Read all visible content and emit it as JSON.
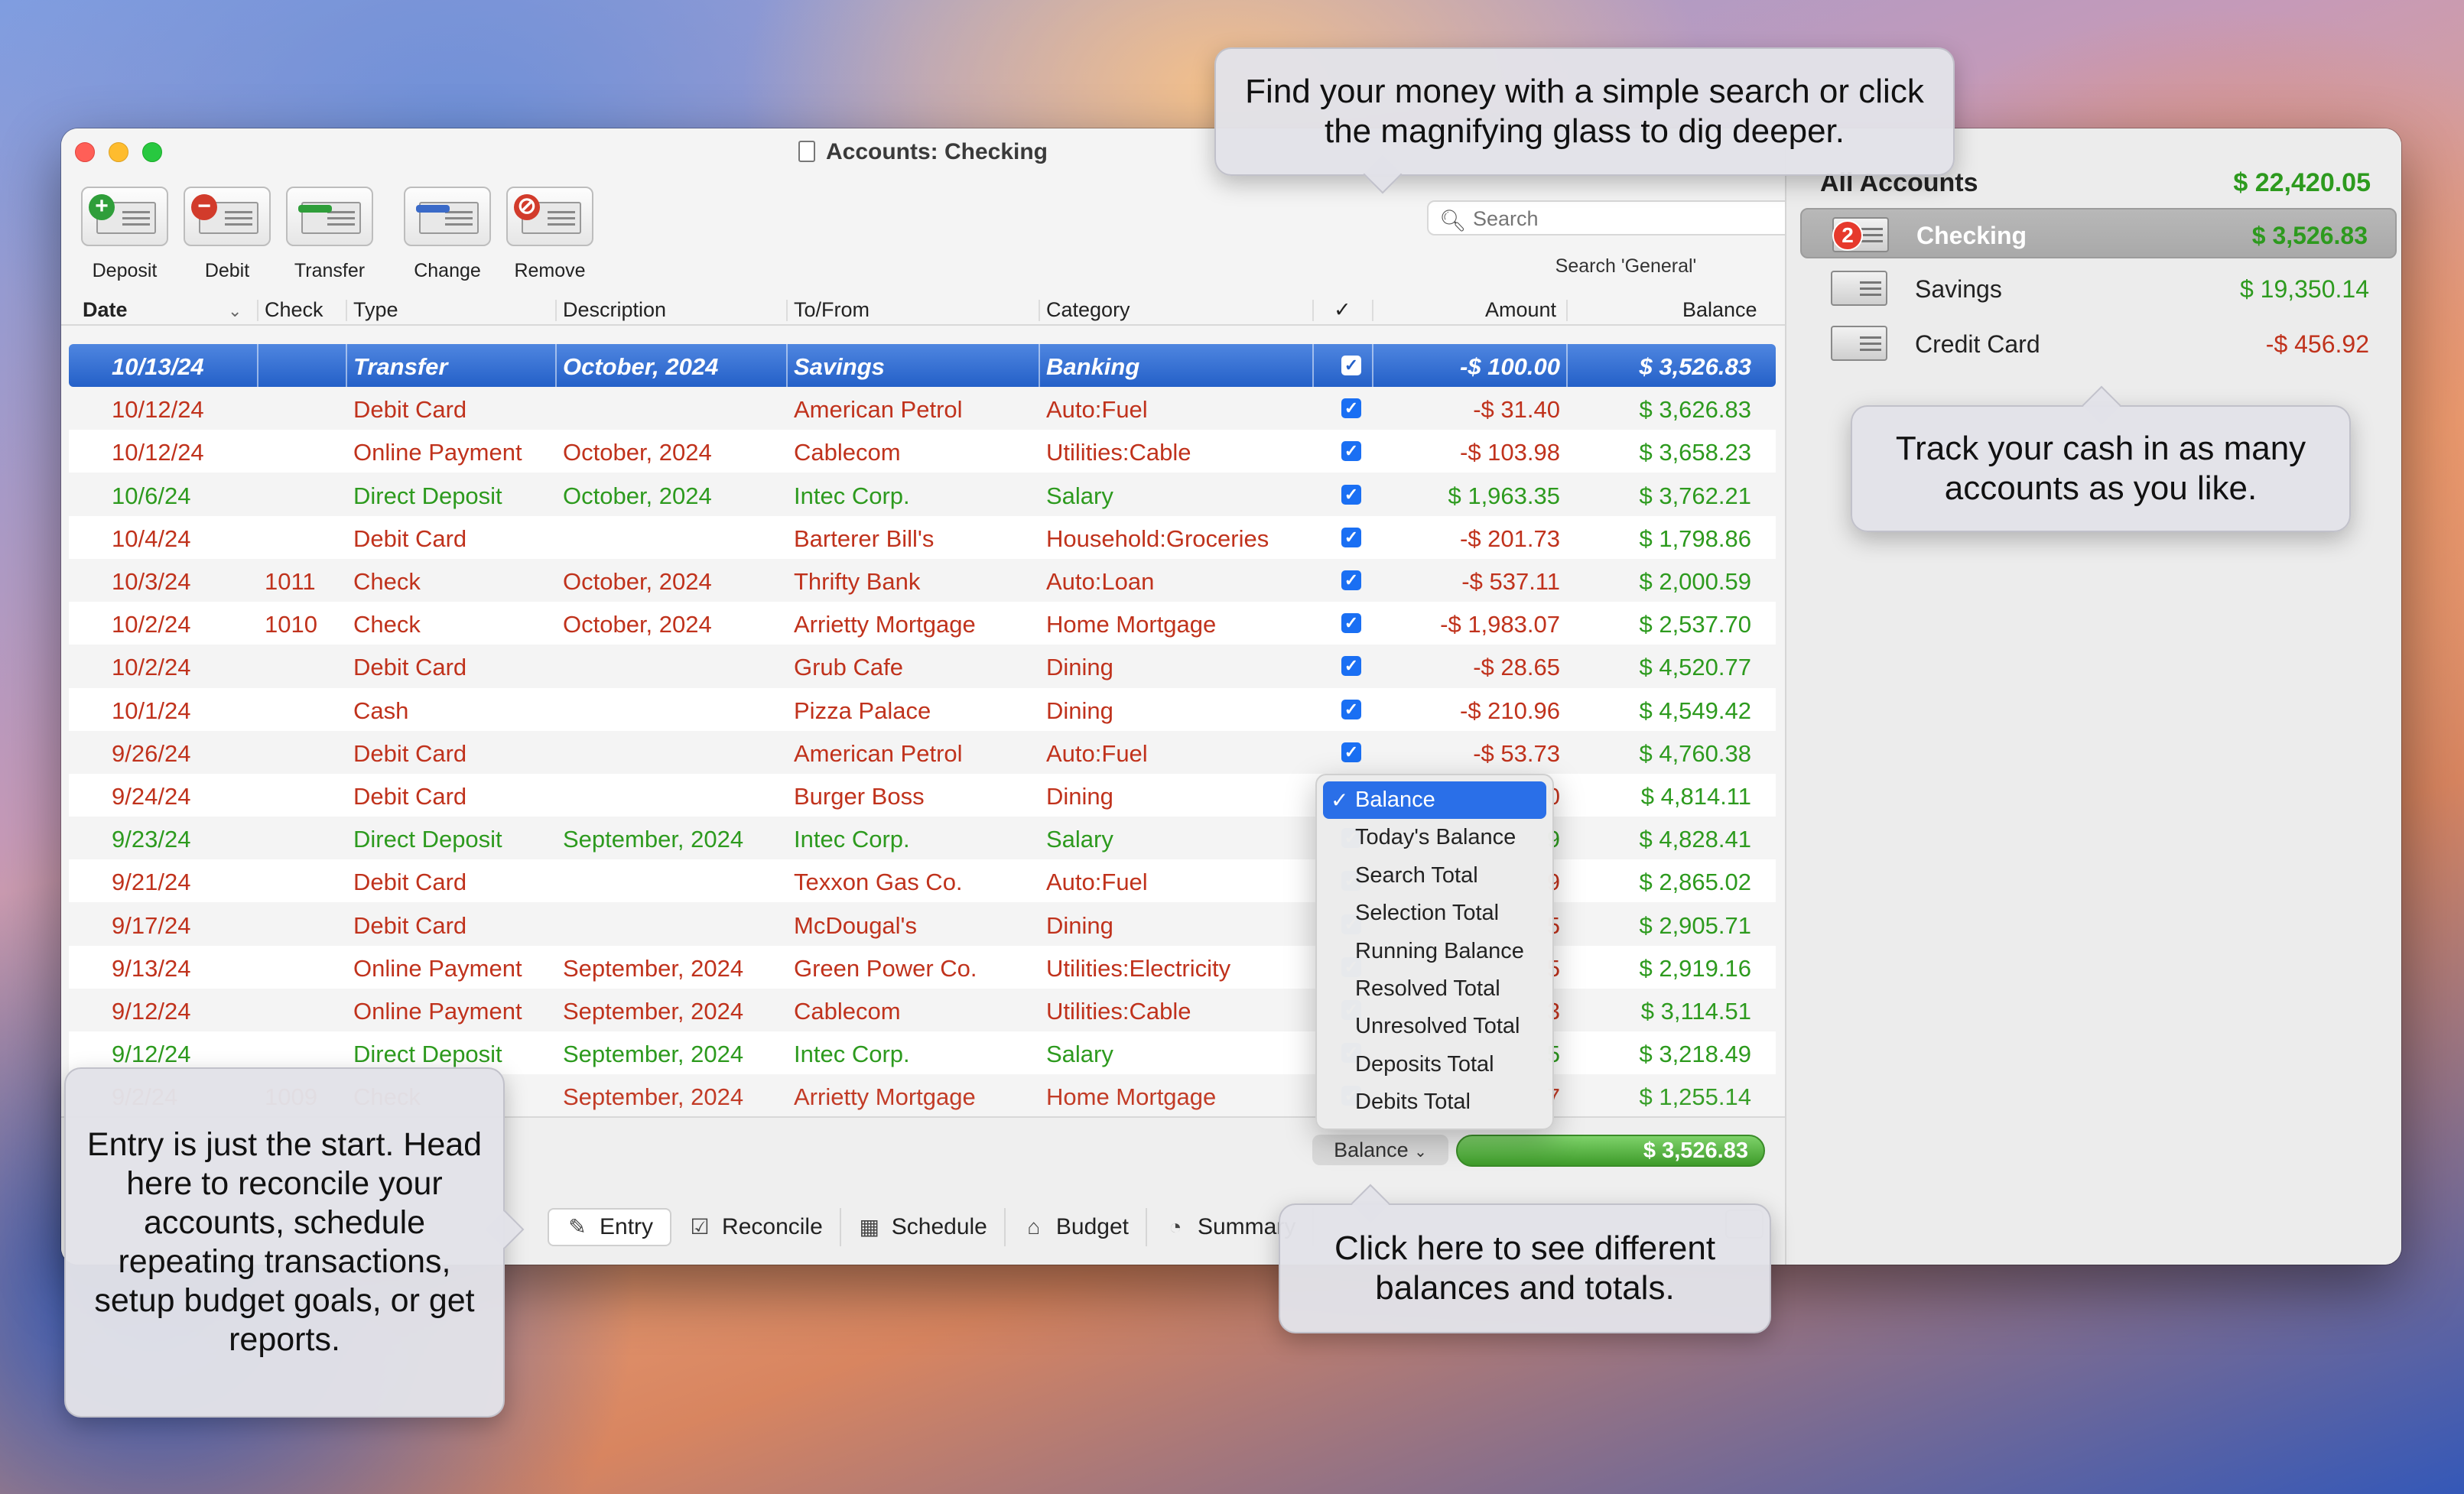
{
  "window": {
    "title": "Accounts:  Checking"
  },
  "toolbar": {
    "buttons": [
      {
        "label": "Deposit",
        "icon": "deposit-icon",
        "color": "#2f9e3a",
        "glyph": "+"
      },
      {
        "label": "Debit",
        "icon": "debit-icon",
        "color": "#d23b2b",
        "glyph": "−"
      },
      {
        "label": "Transfer",
        "icon": "transfer-icon",
        "color": "#2f9e3a",
        "glyph": ""
      },
      {
        "label": "Change",
        "icon": "change-icon",
        "color": "#3a6ac8",
        "glyph": ""
      },
      {
        "label": "Remove",
        "icon": "remove-icon",
        "color": "#d23b2b",
        "glyph": "⊘"
      }
    ]
  },
  "search": {
    "placeholder": "Search",
    "scope": "Search 'General'"
  },
  "columns": {
    "date": "Date",
    "check": "Check",
    "type": "Type",
    "description": "Description",
    "tofrom": "To/From",
    "category": "Category",
    "cleared": "✓",
    "amount": "Amount",
    "balance": "Balance"
  },
  "transactions": [
    {
      "date": "10/13/24",
      "check": "",
      "type": "Transfer",
      "description": "October, 2024",
      "tofrom": "Savings",
      "category": "Banking",
      "amount": "-$ 100.00",
      "balance": "$ 3,526.83",
      "kind": "sel"
    },
    {
      "date": "10/12/24",
      "check": "",
      "type": "Debit Card",
      "description": "",
      "tofrom": "American Petrol",
      "category": "Auto:Fuel",
      "amount": "-$ 31.40",
      "balance": "$ 3,626.83",
      "kind": "red"
    },
    {
      "date": "10/12/24",
      "check": "",
      "type": "Online Payment",
      "description": "October, 2024",
      "tofrom": "Cablecom",
      "category": "Utilities:Cable",
      "amount": "-$ 103.98",
      "balance": "$ 3,658.23",
      "kind": "red"
    },
    {
      "date": "10/6/24",
      "check": "",
      "type": "Direct Deposit",
      "description": "October, 2024",
      "tofrom": "Intec Corp.",
      "category": "Salary",
      "amount": "$ 1,963.35",
      "balance": "$ 3,762.21",
      "kind": "green"
    },
    {
      "date": "10/4/24",
      "check": "",
      "type": "Debit Card",
      "description": "",
      "tofrom": "Barterer Bill's",
      "category": "Household:Groceries",
      "amount": "-$ 201.73",
      "balance": "$ 1,798.86",
      "kind": "red"
    },
    {
      "date": "10/3/24",
      "check": "1011",
      "type": "Check",
      "description": "October, 2024",
      "tofrom": "Thrifty Bank",
      "category": "Auto:Loan",
      "amount": "-$ 537.11",
      "balance": "$ 2,000.59",
      "kind": "red"
    },
    {
      "date": "10/2/24",
      "check": "1010",
      "type": "Check",
      "description": "October, 2024",
      "tofrom": "Arrietty Mortgage",
      "category": "Home Mortgage",
      "amount": "-$ 1,983.07",
      "balance": "$ 2,537.70",
      "kind": "red"
    },
    {
      "date": "10/2/24",
      "check": "",
      "type": "Debit Card",
      "description": "",
      "tofrom": "Grub Cafe",
      "category": "Dining",
      "amount": "-$ 28.65",
      "balance": "$ 4,520.77",
      "kind": "red"
    },
    {
      "date": "10/1/24",
      "check": "",
      "type": "Cash",
      "description": "",
      "tofrom": "Pizza Palace",
      "category": "Dining",
      "amount": "-$ 210.96",
      "balance": "$ 4,549.42",
      "kind": "red"
    },
    {
      "date": "9/26/24",
      "check": "",
      "type": "Debit Card",
      "description": "",
      "tofrom": "American Petrol",
      "category": "Auto:Fuel",
      "amount": "-$ 53.73",
      "balance": "$ 4,760.38",
      "kind": "red"
    },
    {
      "date": "9/24/24",
      "check": "",
      "type": "Debit Card",
      "description": "",
      "tofrom": "Burger Boss",
      "category": "Dining",
      "amount": "0",
      "balance": "$ 4,814.11",
      "kind": "red"
    },
    {
      "date": "9/23/24",
      "check": "",
      "type": "Direct Deposit",
      "description": "September, 2024",
      "tofrom": "Intec Corp.",
      "category": "Salary",
      "amount": "9",
      "balance": "$ 4,828.41",
      "kind": "green"
    },
    {
      "date": "9/21/24",
      "check": "",
      "type": "Debit Card",
      "description": "",
      "tofrom": "Texxon Gas Co.",
      "category": "Auto:Fuel",
      "amount": "9",
      "balance": "$ 2,865.02",
      "kind": "red"
    },
    {
      "date": "9/17/24",
      "check": "",
      "type": "Debit Card",
      "description": "",
      "tofrom": "McDougal's",
      "category": "Dining",
      "amount": "5",
      "balance": "$ 2,905.71",
      "kind": "red"
    },
    {
      "date": "9/13/24",
      "check": "",
      "type": "Online Payment",
      "description": "September, 2024",
      "tofrom": "Green Power Co.",
      "category": "Utilities:Electricity",
      "amount": "5",
      "balance": "$ 2,919.16",
      "kind": "red"
    },
    {
      "date": "9/12/24",
      "check": "",
      "type": "Online Payment",
      "description": "September, 2024",
      "tofrom": "Cablecom",
      "category": "Utilities:Cable",
      "amount": "3",
      "balance": "$ 3,114.51",
      "kind": "red"
    },
    {
      "date": "9/12/24",
      "check": "",
      "type": "Direct Deposit",
      "description": "September, 2024",
      "tofrom": "Intec Corp.",
      "category": "Salary",
      "amount": "5",
      "balance": "$ 3,218.49",
      "kind": "green"
    },
    {
      "date": "9/2/24",
      "check": "1009",
      "type": "Check",
      "description": "September, 2024",
      "tofrom": "Arrietty Mortgage",
      "category": "Home Mortgage",
      "amount": "7",
      "balance": "$ 1,255.14",
      "kind": "red"
    }
  ],
  "balance_control": {
    "label": "Balance",
    "value": "$ 3,526.83"
  },
  "balance_menu": {
    "items": [
      "Balance",
      "Today's Balance",
      "Search Total",
      "Selection Total",
      "Running Balance",
      "Resolved Total",
      "Unresolved Total",
      "Deposits Total",
      "Debits Total"
    ],
    "checked": "Balance"
  },
  "tabs": [
    {
      "label": "Entry",
      "icon": "entry-icon",
      "glyph": "✎"
    },
    {
      "label": "Reconcile",
      "icon": "reconcile-icon",
      "glyph": "☑"
    },
    {
      "label": "Schedule",
      "icon": "schedule-icon",
      "glyph": "▦"
    },
    {
      "label": "Budget",
      "icon": "budget-icon",
      "glyph": "⌂"
    },
    {
      "label": "Summary",
      "icon": "summary-icon",
      "glyph": "◔"
    }
  ],
  "accounts": {
    "all_label": "All Accounts",
    "all_total": "$ 22,420.05",
    "items": [
      {
        "name": "Checking",
        "amount": "$ 3,526.83",
        "badge": "2",
        "icon": "checking-icon"
      },
      {
        "name": "Savings",
        "amount": "$ 19,350.14",
        "badge": "",
        "icon": "savings-chest-icon"
      },
      {
        "name": "Credit Card",
        "amount": "-$ 456.92",
        "badge": "",
        "icon": "credit-card-icon"
      }
    ]
  },
  "callouts": {
    "search": "Find your money with a simple search or click the magnifying glass to dig deeper.",
    "accounts": "Track your cash in as many accounts as you like.",
    "tabs": "Entry is just the start. Head here to reconcile your accounts, schedule repeating transactions, setup budget goals, or get reports.",
    "balance": "Click here to see different balances and totals."
  },
  "colors": {
    "debit": "#c0321c",
    "credit": "#2d9a1e",
    "selection": "#2460c8",
    "accent": "#2a6fe8"
  }
}
